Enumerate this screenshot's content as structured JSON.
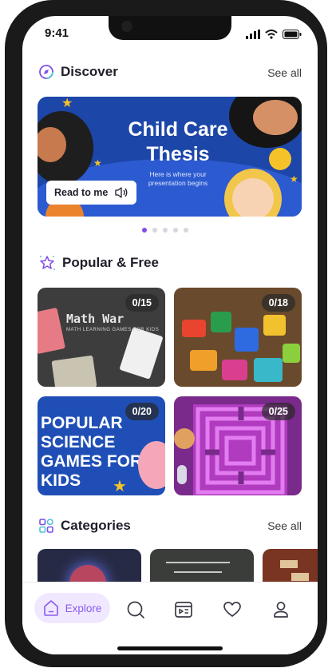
{
  "status": {
    "time": "9:41"
  },
  "discover": {
    "title": "Discover",
    "see_all": "See all"
  },
  "hero": {
    "title_line1": "Child Care",
    "title_line2": "Thesis",
    "subtitle_line1": "Here is where your",
    "subtitle_line2": "presentation begins",
    "read_button": "Read to me"
  },
  "carousel": {
    "total": 5,
    "active": 1
  },
  "popular": {
    "title": "Popular & Free",
    "cards": [
      {
        "count": "0/15",
        "title": "Math War",
        "subtitle": "MATH LEARNING GAMES FOR KIDS"
      },
      {
        "count": "0/18"
      },
      {
        "count": "0/20",
        "lines": [
          "POPULAR",
          "SCIENCE",
          "GAMES FOR",
          "KIDS"
        ]
      },
      {
        "count": "0/25"
      }
    ]
  },
  "categories": {
    "title": "Categories",
    "see_all": "See all"
  },
  "nav": {
    "explore": "Explore"
  },
  "colors": {
    "accent": "#7d4ee8",
    "nav_active_bg": "#f0e8ff",
    "hero_bg": "#1c46a8"
  },
  "icons": [
    "compass-icon",
    "star-icon",
    "grid-icon",
    "home-icon",
    "search-icon",
    "slides-icon",
    "heart-icon",
    "profile-icon",
    "speaker-icon"
  ]
}
